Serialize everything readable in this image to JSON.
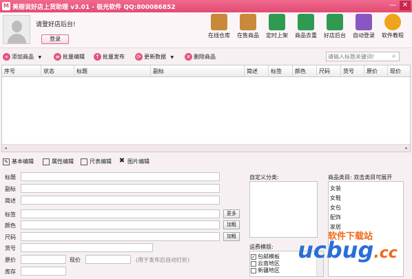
{
  "window": {
    "title": "美丽说好店上货助理 v3.01 - 极光软件 QQ:800086852",
    "app_icon": "M",
    "minimize": "—",
    "close": "✕"
  },
  "user": {
    "greeting": "请登好店后台!",
    "login_label": "登录"
  },
  "tools": [
    {
      "label": "在线仓库",
      "icon": "warehouse-icon",
      "color": "#c8893a"
    },
    {
      "label": "在售商品",
      "icon": "on-sale-icon",
      "color": "#c8893a"
    },
    {
      "label": "定时上架",
      "icon": "timer-icon",
      "color": "#2f9a52"
    },
    {
      "label": "商品去重",
      "icon": "dedupe-icon",
      "color": "#2f9a52"
    },
    {
      "label": "好店后台",
      "icon": "shop-backend-icon",
      "color": "#2f9a52"
    },
    {
      "label": "自动登录",
      "icon": "auto-login-icon",
      "color": "#8a56c2"
    },
    {
      "label": "软件教程",
      "icon": "tutorial-icon",
      "color": "#f0a31c"
    }
  ],
  "actions": {
    "add": "添加商品",
    "batch_edit": "批量编辑",
    "batch_publish": "批量发布",
    "update": "更新数据",
    "delete": "删除商品",
    "dropdown_arrow": "▼",
    "search_placeholder": "请输入标题关键词!",
    "search_icon": "⌕"
  },
  "grid": {
    "columns": [
      "序号",
      "状态",
      "标题",
      "副标",
      "简述",
      "标签",
      "颜色",
      "尺码",
      "货号",
      "原价",
      "现价"
    ],
    "scroll_left": "◂",
    "scroll_right": "▸"
  },
  "edit_tabs": {
    "basic": "基本编辑",
    "attr": "属性编辑",
    "size": "尺表编辑",
    "image": "图片编辑"
  },
  "form": {
    "title": "标题",
    "subtitle": "副标",
    "summary": "简述",
    "tag": "标签",
    "color": "颜色",
    "size": "尺码",
    "sku": "货号",
    "orig_price": "原价",
    "cur_price": "现价",
    "price_note": "(用于发布后自动打折)",
    "stock": "库存",
    "more": "更多",
    "add_color": "加粗",
    "add_size": "加粗"
  },
  "custom_category": {
    "label": "自定义分类:"
  },
  "shipping": {
    "label": "运费模版:",
    "options": [
      {
        "label": "包邮模板",
        "checked": true
      },
      {
        "label": "云南地区",
        "checked": false
      },
      {
        "label": "新疆地区",
        "checked": false
      }
    ]
  },
  "product_category": {
    "label": "商品类目:  双击类目可展开",
    "items": [
      "女装",
      "女鞋",
      "女包",
      "配饰",
      "家居"
    ]
  },
  "watermark": {
    "logo": "ucbug",
    "suffix": ".cc",
    "sub": "软件下载站"
  }
}
